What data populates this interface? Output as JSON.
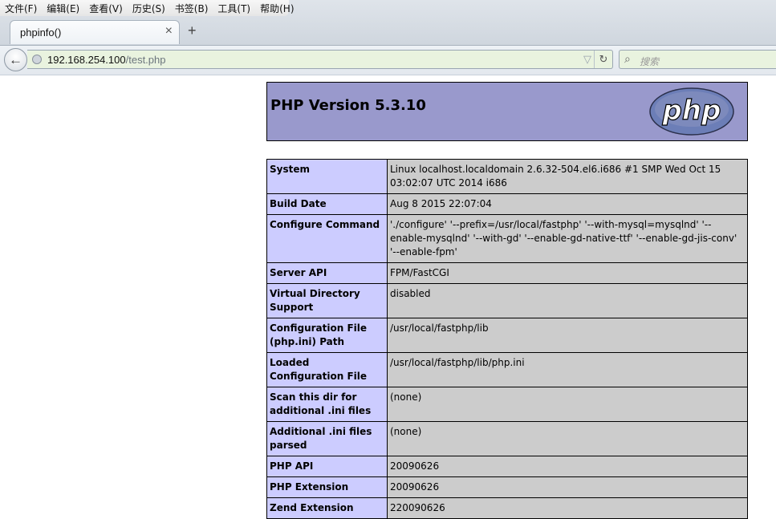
{
  "menu": [
    "文件(F)",
    "编辑(E)",
    "查看(V)",
    "历史(S)",
    "书签(B)",
    "工具(T)",
    "帮助(H)"
  ],
  "tab": {
    "title": "phpinfo()",
    "close": "×",
    "new": "+"
  },
  "nav": {
    "back": "←",
    "url_host": "192.168.254.100",
    "url_path": "/test.php",
    "bookmark": "▽",
    "reload": "↻",
    "search_placeholder": "搜索"
  },
  "page": {
    "title": "PHP Version 5.3.10",
    "logo_text": "php",
    "rows": [
      {
        "label": "System",
        "value": "Linux localhost.localdomain 2.6.32-504.el6.i686 #1 SMP Wed Oct 15 03:02:07 UTC 2014 i686"
      },
      {
        "label": "Build Date",
        "value": "Aug 8 2015 22:07:04"
      },
      {
        "label": "Configure Command",
        "value": "'./configure' '--prefix=/usr/local/fastphp' '--with-mysql=mysqlnd' '--enable-mysqlnd' '--with-gd' '--enable-gd-native-ttf' '--enable-gd-jis-conv' '--enable-fpm'"
      },
      {
        "label": "Server API",
        "value": "FPM/FastCGI"
      },
      {
        "label": "Virtual Directory Support",
        "value": "disabled"
      },
      {
        "label": "Configuration File (php.ini) Path",
        "value": "/usr/local/fastphp/lib"
      },
      {
        "label": "Loaded Configuration File",
        "value": "/usr/local/fastphp/lib/php.ini"
      },
      {
        "label": "Scan this dir for additional .ini files",
        "value": "(none)"
      },
      {
        "label": "Additional .ini files parsed",
        "value": "(none)"
      },
      {
        "label": "PHP API",
        "value": "20090626"
      },
      {
        "label": "PHP Extension",
        "value": "20090626"
      },
      {
        "label": "Zend Extension",
        "value": "220090626"
      }
    ]
  },
  "colors": {
    "header_bg": "#9999cc",
    "label_bg": "#ccccff",
    "value_bg": "#cccccc",
    "urlbar_bg": "#e9f3df"
  }
}
